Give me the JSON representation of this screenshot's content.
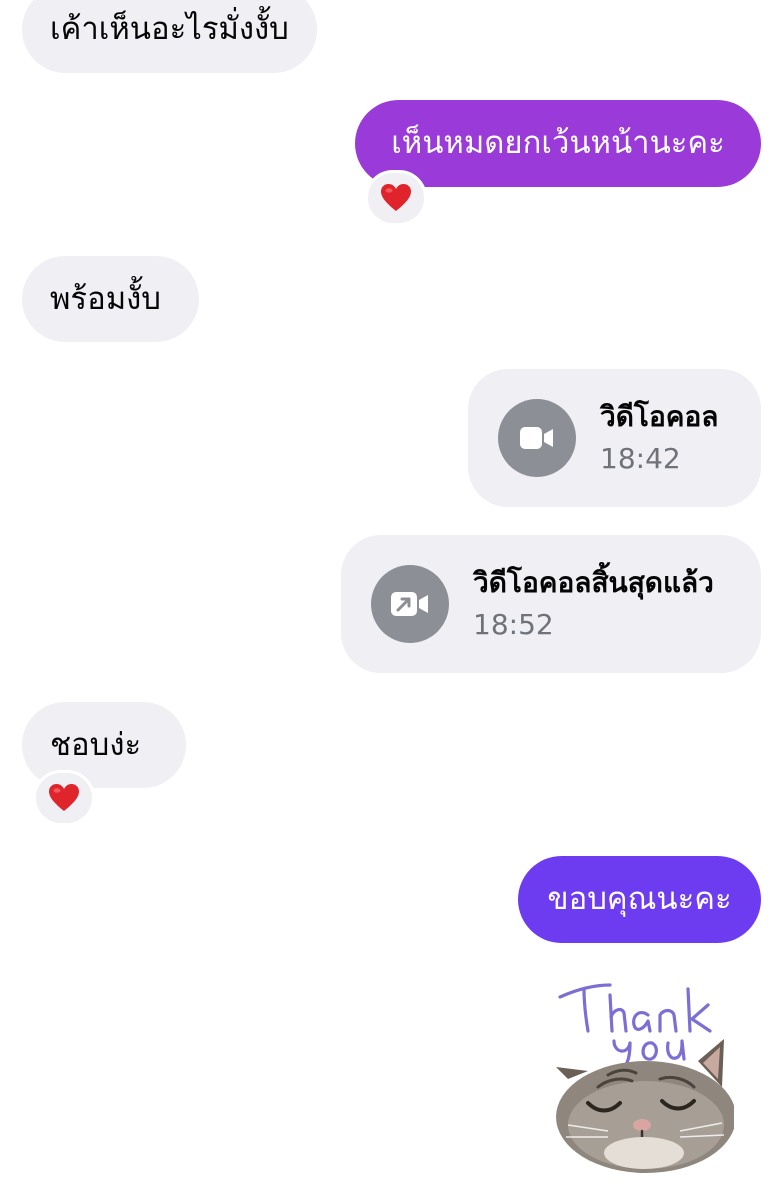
{
  "messages": [
    {
      "id": "m1",
      "direction": "incoming",
      "text": "เค้าเห็นอะไรมั่งงั้บ"
    },
    {
      "id": "m2",
      "direction": "outgoing",
      "text": "เห็นหมดยกเว้นหน้านะคะ",
      "color": "#993ad9",
      "reaction": "heart-emoji"
    },
    {
      "id": "m3",
      "direction": "incoming",
      "text": "พร้อมงั้บ"
    },
    {
      "id": "m4",
      "type": "video-call",
      "direction": "outgoing",
      "title": "วิดีโอคอล",
      "time": "18:42",
      "icon": "video-camera-icon"
    },
    {
      "id": "m5",
      "type": "video-call-ended",
      "direction": "outgoing",
      "title": "วิดีโอคอลสิ้นสุดแล้ว",
      "time": "18:52",
      "icon": "video-call-ended-icon"
    },
    {
      "id": "m6",
      "direction": "incoming",
      "text": "ชอบง่ะ",
      "reaction": "heart-emoji"
    },
    {
      "id": "m7",
      "direction": "outgoing",
      "text": "ขอบคุณนะคะ",
      "color": "#6d3bf0"
    },
    {
      "id": "m8",
      "type": "sticker",
      "direction": "outgoing",
      "sticker_text": "Thank you",
      "sticker": "cat-thank-you-sticker"
    }
  ],
  "colors": {
    "incoming_bubble": "#efeff4",
    "heart": "#e0242b",
    "call_icon_bg": "#8c8f96",
    "sticker_text": "#7b6fd6"
  }
}
